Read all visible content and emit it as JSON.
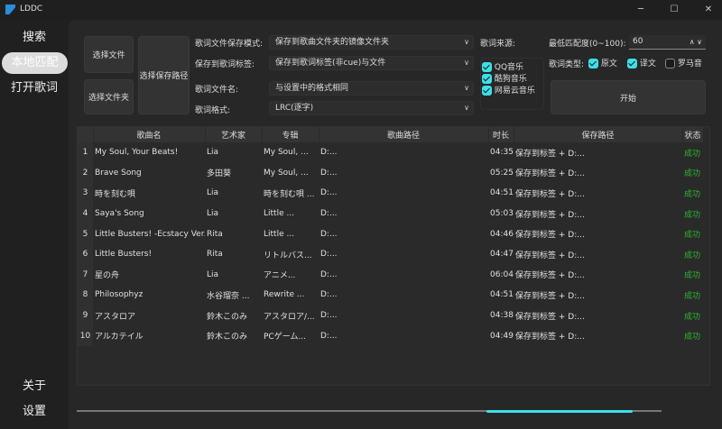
{
  "window": {
    "title": "LDDC",
    "controls": [
      "─",
      "☐",
      "✕"
    ]
  },
  "sidebar": {
    "items": [
      {
        "label": "搜索"
      },
      {
        "label": "本地匹配",
        "active": true
      },
      {
        "label": "打开歌词"
      }
    ],
    "bottom": [
      {
        "label": "关于"
      },
      {
        "label": "设置"
      }
    ]
  },
  "actions": {
    "select_file": "选择文件",
    "select_folder": "选择文件夹",
    "select_save_path": "选择保存路径",
    "start": "开始"
  },
  "form": {
    "save_mode": {
      "label": "歌词文件保存模式:",
      "value": "保存到歌曲文件夹的镜像文件夹"
    },
    "save_tag": {
      "label": "保存到歌词标签:",
      "value": "保存到歌词标签(非cue)与文件"
    },
    "filename": {
      "label": "歌词文件名:",
      "value": "与设置中的格式相同"
    },
    "format": {
      "label": "歌词格式:",
      "value": "LRC(逐字)"
    }
  },
  "sources": {
    "label": "歌词来源:",
    "items": [
      {
        "label": "QQ音乐",
        "checked": true
      },
      {
        "label": "酷狗音乐",
        "checked": true
      },
      {
        "label": "网易云音乐",
        "checked": true
      }
    ]
  },
  "min_score": {
    "label": "最低匹配度(0~100):",
    "value": "60"
  },
  "lyric_types": {
    "label": "歌词类型:",
    "items": [
      {
        "label": "原文",
        "checked": true
      },
      {
        "label": "译文",
        "checked": true
      },
      {
        "label": "罗马音",
        "checked": false
      }
    ]
  },
  "table": {
    "columns": [
      "歌曲名",
      "艺术家",
      "专辑",
      "歌曲路径",
      "时长",
      "保存路径",
      "状态"
    ],
    "rows": [
      [
        "1",
        "My Soul, Your Beats!",
        "Lia",
        "My Soul, ...",
        "D:...",
        "04:35",
        "保存到标签 + D:...",
        "成功"
      ],
      [
        "2",
        "Brave Song",
        "多田葵",
        "My Soul, ...",
        "D:...",
        "05:25",
        "保存到标签 + D:...",
        "成功"
      ],
      [
        "3",
        "時を刻む唄",
        "Lia",
        "時を刻む唄 ...",
        "D:...",
        "04:51",
        "保存到标签 + D:...",
        "成功"
      ],
      [
        "4",
        "Saya's Song",
        "Lia",
        "Little ...",
        "D:...",
        "05:03",
        "保存到标签 + D:...",
        "成功"
      ],
      [
        "5",
        "Little Busters! -Ecstacy Ver.-",
        "Rita",
        "Little ...",
        "D:...",
        "04:46",
        "保存到标签 + D:...",
        "成功"
      ],
      [
        "6",
        "Little Busters!",
        "Rita",
        "リトルバス...",
        "D:...",
        "04:47",
        "保存到标签 + D:...",
        "成功"
      ],
      [
        "7",
        "星の舟",
        "Lia",
        "アニメ...",
        "D:...",
        "06:04",
        "保存到标签 + D:...",
        "成功"
      ],
      [
        "8",
        "Philosophyz",
        "水谷瑠奈 ...",
        "Rewrite ...",
        "D:...",
        "04:51",
        "保存到标签 + D:...",
        "成功"
      ],
      [
        "9",
        "アスタロア",
        "鈴木このみ",
        "アスタロア/...",
        "D:...",
        "04:38",
        "保存到标签 + D:...",
        "成功"
      ],
      [
        "10",
        "アルカテイル",
        "鈴木このみ",
        "PCゲーム...",
        "D:...",
        "04:49",
        "保存到标签 + D:...",
        "成功"
      ]
    ]
  },
  "progress": {
    "start_fraction": 0.7,
    "end_fraction": 0.95
  },
  "colors": {
    "accent": "#3de0e8",
    "success": "#2db52d"
  }
}
